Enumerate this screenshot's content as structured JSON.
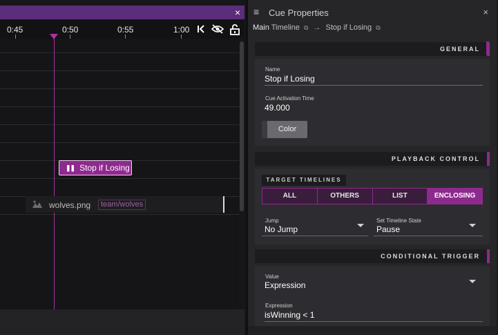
{
  "timeline": {
    "close_icon": "×",
    "ruler_ticks": [
      "0:45",
      "0:50",
      "0:55",
      "1:00"
    ],
    "icons": {
      "skip_back": "|<",
      "visibility": "eye-off-icon",
      "lock": "unlock-icon"
    },
    "cue_block": {
      "label": "Stop if Losing",
      "pause_icon": "❚❚"
    },
    "media": {
      "name": "wolves.png",
      "tag": "team/wolves"
    },
    "accent_color": "#8e2a8e"
  },
  "properties": {
    "title": "Cue Properties",
    "menu_icon": "≡",
    "close_icon": "×",
    "breadcrumb": {
      "root_bold": "Main",
      "root_rest": "Timeline",
      "separator": "→",
      "current": "Stop if Losing"
    },
    "sections": {
      "general": "GENERAL",
      "playback": "PLAYBACK CONTROL",
      "conditional": "CONDITIONAL TRIGGER"
    },
    "name": {
      "label": "Name",
      "value": "Stop if Losing"
    },
    "activation": {
      "label": "Cue Activation Time",
      "value": "49.000"
    },
    "color_button": "Color",
    "target_timelines": {
      "label": "TARGET TIMELINES",
      "options": [
        "ALL",
        "OTHERS",
        "LIST",
        "ENCLOSING"
      ],
      "selected": "ENCLOSING"
    },
    "jump": {
      "label": "Jump",
      "value": "No Jump"
    },
    "set_state": {
      "label": "Set Timeline State",
      "value": "Pause"
    },
    "trigger_value": {
      "label": "Value",
      "value": "Expression"
    },
    "expression": {
      "label": "Expression",
      "value": "isWinning < 1"
    }
  }
}
